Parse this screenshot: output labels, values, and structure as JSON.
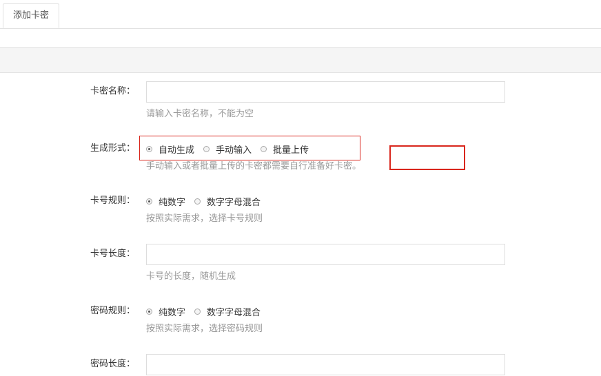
{
  "tabs": [
    {
      "label": "添加卡密"
    }
  ],
  "form": {
    "card_name": {
      "label": "卡密名称：",
      "value": "",
      "hint": "请输入卡密名称，不能为空"
    },
    "gen_mode": {
      "label": "生成形式：",
      "options": [
        "自动生成",
        "手动输入",
        "批量上传"
      ],
      "selected": "自动生成",
      "hint": "手动输入或者批量上传的卡密都需要自行准备好卡密。"
    },
    "card_rule": {
      "label": "卡号规则：",
      "options": [
        "纯数字",
        "数字字母混合"
      ],
      "selected": "纯数字",
      "hint": "按照实际需求，选择卡号规则"
    },
    "card_length": {
      "label": "卡号长度：",
      "value": "",
      "hint": "卡号的长度，随机生成"
    },
    "pwd_rule": {
      "label": "密码规则：",
      "options": [
        "纯数字",
        "数字字母混合"
      ],
      "selected": "纯数字",
      "hint": "按照实际需求，选择密码规则"
    },
    "pwd_length": {
      "label": "密码长度：",
      "value": ""
    }
  },
  "annotation_color": "#d9261c"
}
